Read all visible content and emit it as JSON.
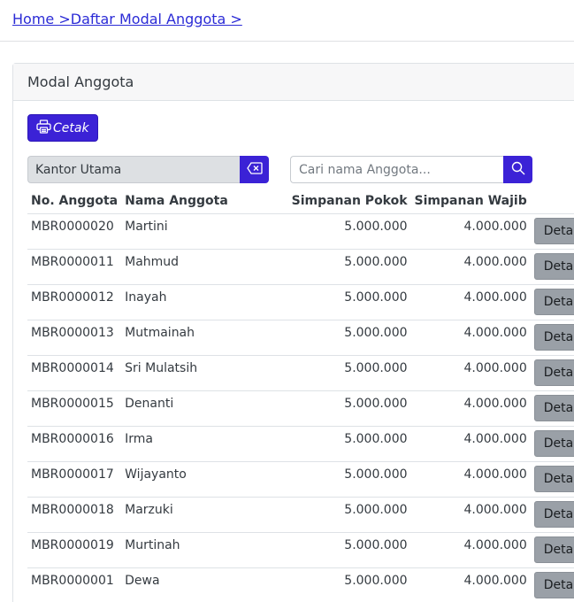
{
  "breadcrumb": {
    "home": "Home >",
    "current": "Daftar Modal Anggota >"
  },
  "card": {
    "title": "Modal Anggota"
  },
  "toolbar": {
    "print_label": "Cetak"
  },
  "filter": {
    "branch_value": "Kantor Utama",
    "search_placeholder": "Cari nama Anggota..."
  },
  "colors": {
    "accent": "#3b22d6",
    "detail_button": "#9aa0a7",
    "link": "#2b2bd6"
  },
  "table": {
    "headers": [
      "No. Anggota",
      "Nama Anggota",
      "Simpanan Pokok",
      "Simpanan Wajib"
    ],
    "detail_label": "Detail",
    "rows": [
      {
        "no": "MBR0000020",
        "name": "Martini",
        "pokok": "5.000.000",
        "wajib": "4.000.000"
      },
      {
        "no": "MBR0000011",
        "name": "Mahmud",
        "pokok": "5.000.000",
        "wajib": "4.000.000"
      },
      {
        "no": "MBR0000012",
        "name": "Inayah",
        "pokok": "5.000.000",
        "wajib": "4.000.000"
      },
      {
        "no": "MBR0000013",
        "name": "Mutmainah",
        "pokok": "5.000.000",
        "wajib": "4.000.000"
      },
      {
        "no": "MBR0000014",
        "name": "Sri Mulatsih",
        "pokok": "5.000.000",
        "wajib": "4.000.000"
      },
      {
        "no": "MBR0000015",
        "name": "Denanti",
        "pokok": "5.000.000",
        "wajib": "4.000.000"
      },
      {
        "no": "MBR0000016",
        "name": "Irma",
        "pokok": "5.000.000",
        "wajib": "4.000.000"
      },
      {
        "no": "MBR0000017",
        "name": "Wijayanto",
        "pokok": "5.000.000",
        "wajib": "4.000.000"
      },
      {
        "no": "MBR0000018",
        "name": "Marzuki",
        "pokok": "5.000.000",
        "wajib": "4.000.000"
      },
      {
        "no": "MBR0000019",
        "name": "Murtinah",
        "pokok": "5.000.000",
        "wajib": "4.000.000"
      },
      {
        "no": "MBR0000001",
        "name": "Dewa",
        "pokok": "5.000.000",
        "wajib": "4.000.000"
      }
    ]
  }
}
